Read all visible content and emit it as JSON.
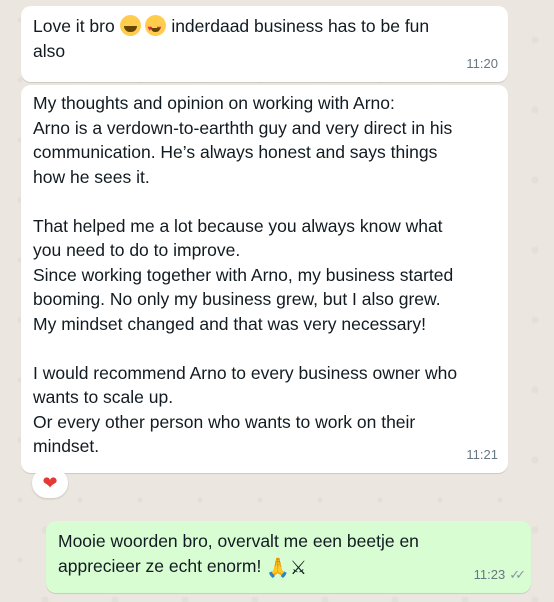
{
  "messages": [
    {
      "line1_before": "Love it bro ",
      "line1_after": " inderdaad business has to be fun",
      "line2": "also",
      "time": "11:20",
      "emojis": [
        "face-with-tears-of-joy-icon",
        "heart-eyes-icon"
      ]
    },
    {
      "text": "My thoughts and opinion on working with Arno:\nArno is a verdown-to-earthth guy and very direct in his\ncommunication. He’s always honest and says things\nhow he sees it.\n\nThat helped me a lot because you always know what\nyou need to do to improve.\nSince working together with Arno, my business started\nbooming. No only my business grew, but I also grew.\nMy mindset changed and that was very necessary!\n\nI would recommend Arno to every business owner who\nwants to scale up.\nOr every other person who wants to work on their\nmindset.",
      "time": "11:21",
      "reaction": "❤"
    },
    {
      "line1": "Mooie woorden bro, overvalt me een beetje en",
      "line2": "apprecieer ze echt enorm! ",
      "emoji1": "🙏",
      "emoji2": "⚔",
      "time": "11:23",
      "ticks": "✓✓"
    }
  ],
  "colors": {
    "incoming": "#ffffff",
    "outgoing": "#d9fdd3",
    "reaction_heart": "#e53935"
  }
}
